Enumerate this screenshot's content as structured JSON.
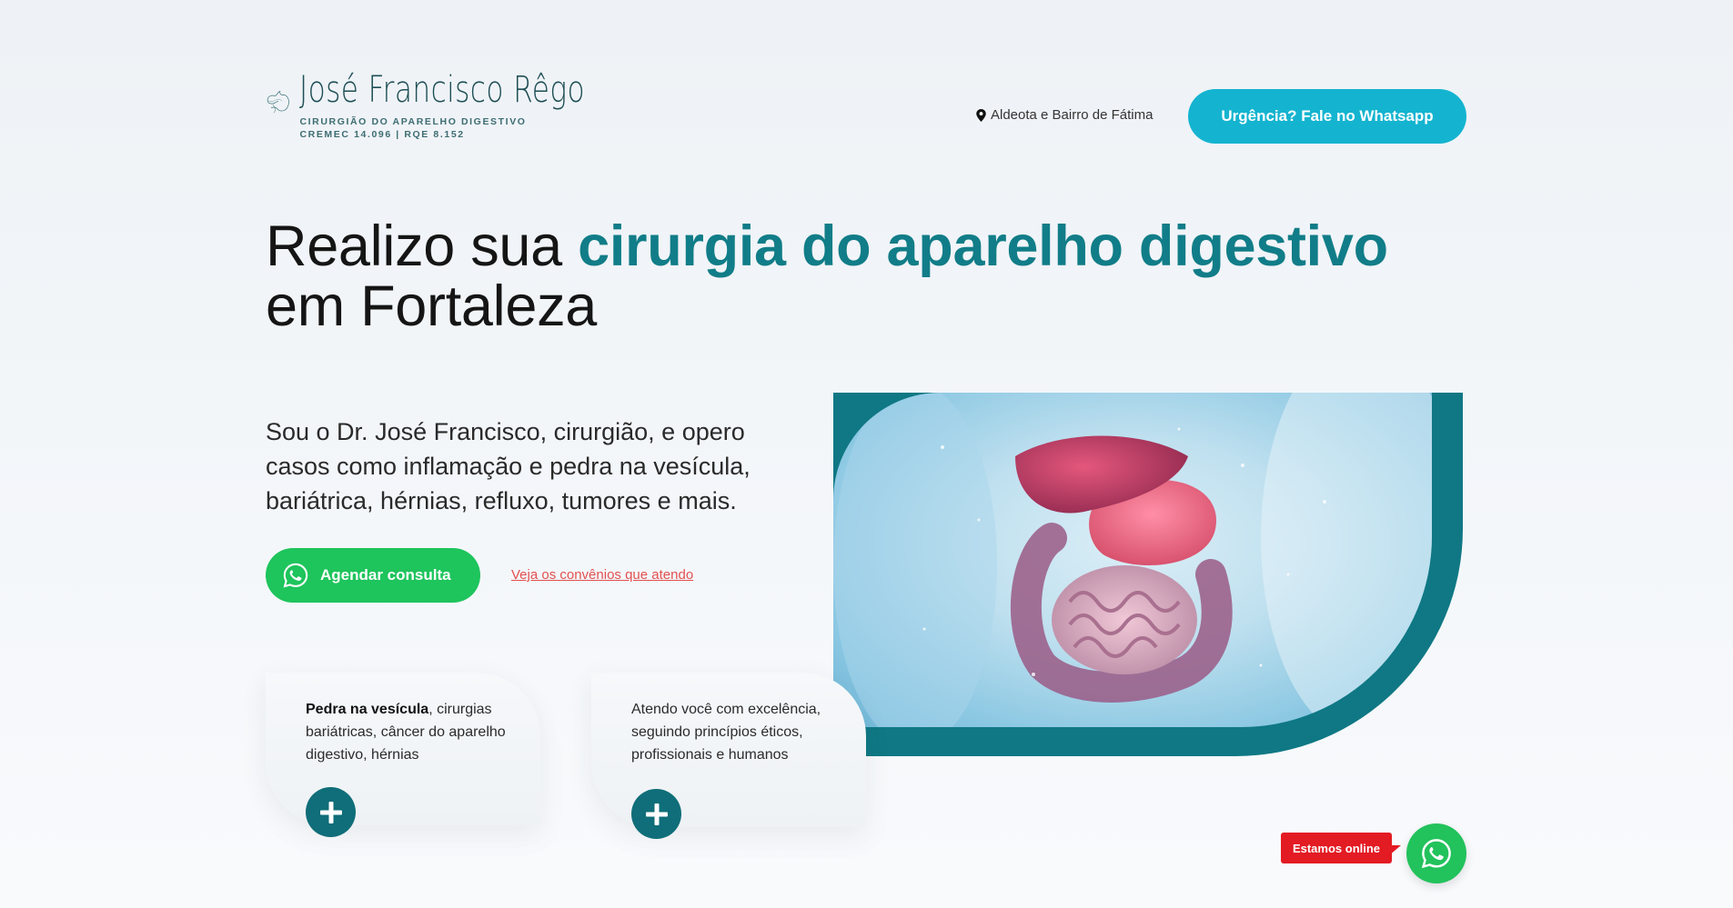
{
  "header": {
    "logo_name": "José Francisco Rêgo",
    "logo_subtitle": "CIRURGIÃO DO APARELHO DIGESTIVO",
    "logo_registry": "CREMEC 14.096 | RQE 8.152",
    "location": "Aldeota e Bairro de Fátima",
    "urgent_button": "Urgência? Fale no Whatsapp"
  },
  "hero": {
    "headline_part1": "Realizo sua ",
    "headline_highlight": "cirurgia do aparelho digestivo",
    "headline_part2": "em Fortaleza",
    "subtext": "Sou o Dr. José Francisco, cirurgião, e opero casos como inflamação e pedra na vesícula, bariátrica, hérnias, refluxo, tumores e mais.",
    "cta_button": "Agendar consulta",
    "convenios_link": "Veja os convênios que atendo"
  },
  "cards": [
    {
      "bold": "Pedra na vesícula",
      "text": ", cirurgias bariátricas, câncer do aparelho digestivo, hérnias"
    },
    {
      "bold": "",
      "text": "Atendo você com excelência, seguindo princípios éticos, profissionais e humanos"
    }
  ],
  "widget": {
    "online_label": "Estamos online"
  },
  "colors": {
    "teal": "#117d88",
    "cyan_button": "#14b4d0",
    "whatsapp_green": "#1ec45c",
    "online_red": "#e31b23"
  }
}
